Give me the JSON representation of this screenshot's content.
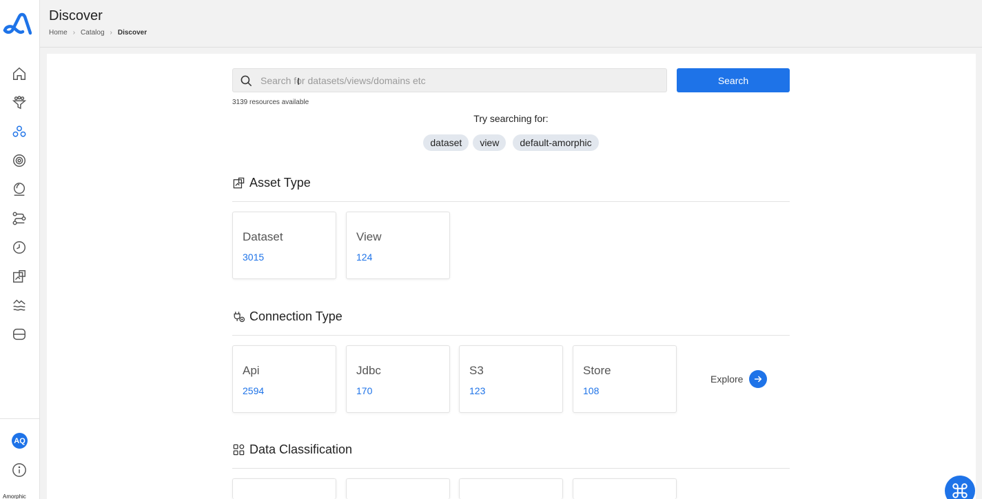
{
  "header": {
    "title": "Discover",
    "breadcrumb": [
      "Home",
      "Catalog",
      "Discover"
    ]
  },
  "sidebar": {
    "items": [
      {
        "icon": "home-icon"
      },
      {
        "icon": "filter-icon"
      },
      {
        "icon": "catalog-icon"
      },
      {
        "icon": "settings-icon"
      },
      {
        "icon": "globe-icon"
      },
      {
        "icon": "workflow-icon"
      },
      {
        "icon": "clock-icon"
      },
      {
        "icon": "asset-icon"
      },
      {
        "icon": "lake-icon"
      },
      {
        "icon": "storage-icon"
      }
    ],
    "avatar_initials": "AQ",
    "brand": "Amorphic"
  },
  "search": {
    "placeholder": "Search for datasets/views/domains etc",
    "button_label": "Search",
    "resources_text": "3139 resources available",
    "try_text": "Try searching for:",
    "suggestions": [
      "dataset",
      "view",
      "default-amorphic"
    ]
  },
  "sections": {
    "asset_type": {
      "title": "Asset Type",
      "cards": [
        {
          "label": "Dataset",
          "count": "3015"
        },
        {
          "label": "View",
          "count": "124"
        }
      ]
    },
    "connection_type": {
      "title": "Connection Type",
      "cards": [
        {
          "label": "Api",
          "count": "2594"
        },
        {
          "label": "Jdbc",
          "count": "170"
        },
        {
          "label": "S3",
          "count": "123"
        },
        {
          "label": "Store",
          "count": "108"
        }
      ],
      "explore_label": "Explore"
    },
    "data_classification": {
      "title": "Data Classification"
    }
  },
  "colors": {
    "accent": "#1e73e8",
    "chip_bg": "#e2e7ee"
  }
}
